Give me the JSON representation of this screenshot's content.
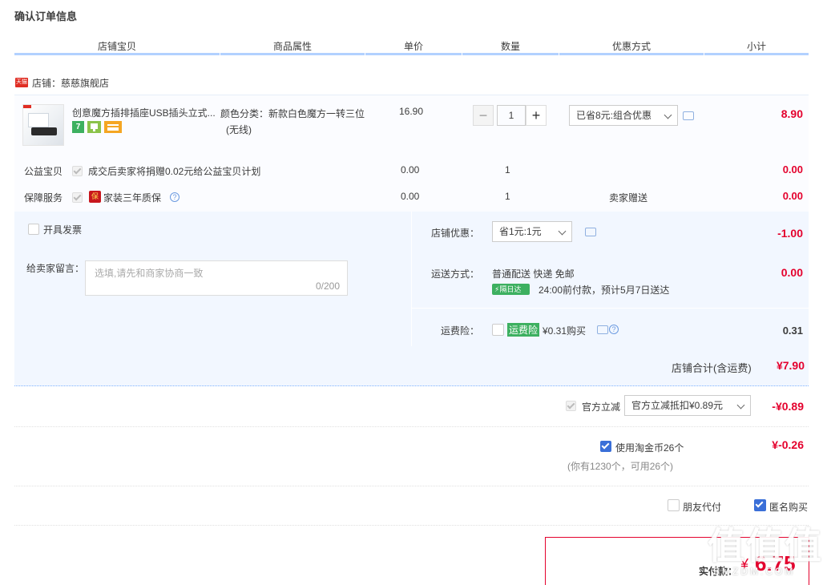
{
  "page": {
    "title": "确认订单信息"
  },
  "headers": [
    "店铺宝贝",
    "商品属性",
    "单价",
    "数量",
    "优惠方式",
    "小计"
  ],
  "shop": {
    "badge": "天猫",
    "name": "店铺：慈慈旗舰店"
  },
  "item": {
    "title": "创意魔方插排插座USB插头立式...",
    "badges": [
      "7",
      "",
      ""
    ],
    "attr_line1": "颜色分类：新款白色魔方一转三位",
    "attr_line2": "(无线)",
    "price": "16.90",
    "qty": "1",
    "minus": "−",
    "plus": "+",
    "discount_select": "已省8元:组合优惠",
    "subtotal": "8.90"
  },
  "charity": {
    "label": "公益宝贝",
    "text": "成交后卖家将捐赠0.02元给公益宝贝计划",
    "price": "0.00",
    "qty": "1",
    "subtotal": "0.00"
  },
  "warranty": {
    "label": "保障服务",
    "icon_text": "保",
    "text": "家装三年质保",
    "price": "0.00",
    "qty": "1",
    "method": "卖家赠送",
    "subtotal": "0.00"
  },
  "invoice": {
    "label": "开具发票"
  },
  "message": {
    "label": "给卖家留言：",
    "placeholder": "选填,请先和商家协商一致",
    "counter": "0/200"
  },
  "shop_discount": {
    "label": "店铺优惠：",
    "select": "省1元:1元",
    "amount": "-1.00"
  },
  "shipping": {
    "label": "运送方式：",
    "method": "普通配送 快递 免邮",
    "tag": "隔日达",
    "eta": "24:00前付款，预计5月7日送达",
    "amount": "0.00"
  },
  "insurance": {
    "label": "运费险：",
    "name": "运费险",
    "price": "¥0.31购买",
    "amount": "0.31"
  },
  "shop_total": {
    "label": "店铺合计(含运费)",
    "amount": "¥7.90"
  },
  "official": {
    "label": "官方立减",
    "select": "官方立减抵扣¥0.89元",
    "amount": "-¥0.89"
  },
  "coins": {
    "label": "使用淘金币26个",
    "sub": "(你有1230个，可用26个)",
    "amount": "¥-0.26"
  },
  "options": {
    "friend_pay": "朋友代付",
    "anonymous": "匿名购买"
  },
  "final": {
    "label": "实付款：",
    "currency": "¥",
    "amount": "6.75"
  },
  "watermark": {
    "text": "值值值",
    "sub": "SMZDM.COM"
  },
  "colors": {
    "accent_red": "#e4012d",
    "header_line": "#b2d1ff",
    "panel_bg": "#f2f7ff",
    "check_blue": "#3a6fd8"
  }
}
